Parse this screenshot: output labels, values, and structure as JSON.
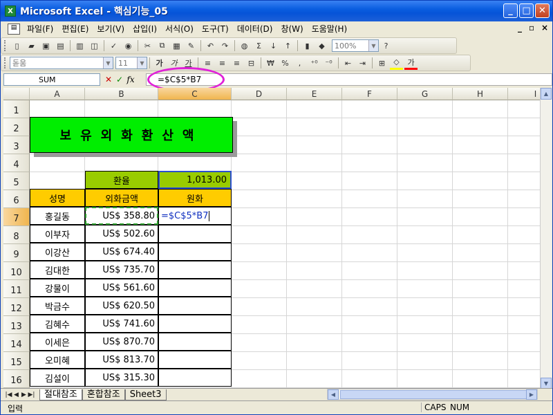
{
  "window": {
    "title": "Microsoft Excel - 핵심기능_05",
    "app_icon": "X"
  },
  "menu": [
    "파일(F)",
    "편집(E)",
    "보기(V)",
    "삽입(I)",
    "서식(O)",
    "도구(T)",
    "데이터(D)",
    "창(W)",
    "도움말(H)"
  ],
  "toolbar": {
    "zoom": "100%",
    "font": "돋움",
    "size": "11",
    "currency": "₩",
    "percent": "%",
    "comma": ",",
    "font_color_glyph": "가"
  },
  "formula_bar": {
    "name_box": "SUM",
    "cancel": "✕",
    "enter": "✓",
    "fx": "fx",
    "content": "=$C$5*B7"
  },
  "columns": [
    "A",
    "B",
    "C",
    "D",
    "E",
    "F",
    "G",
    "H",
    "I"
  ],
  "rows": [
    "1",
    "2",
    "3",
    "4",
    "5",
    "6",
    "7",
    "8",
    "9",
    "10",
    "11",
    "12",
    "13",
    "14",
    "15",
    "16"
  ],
  "sheet": {
    "title": "보유외화환산액",
    "rate_label": "환율",
    "rate_value": "1,013.00",
    "headers": {
      "name": "성명",
      "foreign": "외화금액",
      "won": "원화"
    },
    "editing_value": "=$C$5*B7",
    "data": [
      {
        "name": "홍길동",
        "amount": "US$  358.80"
      },
      {
        "name": "이부자",
        "amount": "US$  502.60"
      },
      {
        "name": "이강산",
        "amount": "US$  674.40"
      },
      {
        "name": "김대한",
        "amount": "US$  735.70"
      },
      {
        "name": "강물이",
        "amount": "US$  561.60"
      },
      {
        "name": "박금수",
        "amount": "US$  620.50"
      },
      {
        "name": "김혜수",
        "amount": "US$  741.60"
      },
      {
        "name": "이세은",
        "amount": "US$  870.70"
      },
      {
        "name": "오미혜",
        "amount": "US$  813.70"
      },
      {
        "name": "김설이",
        "amount": "US$  315.30"
      }
    ]
  },
  "tabs": [
    "절대참조",
    "혼합참조",
    "Sheet3"
  ],
  "status": {
    "mode": "입력",
    "caps": "CAPS",
    "num": "NUM"
  },
  "colors": {
    "title_fill": "#00ee00",
    "rate_fill": "#99cc00",
    "header_fill": "#ffcc00",
    "highlight_circle": "#e020d8"
  }
}
